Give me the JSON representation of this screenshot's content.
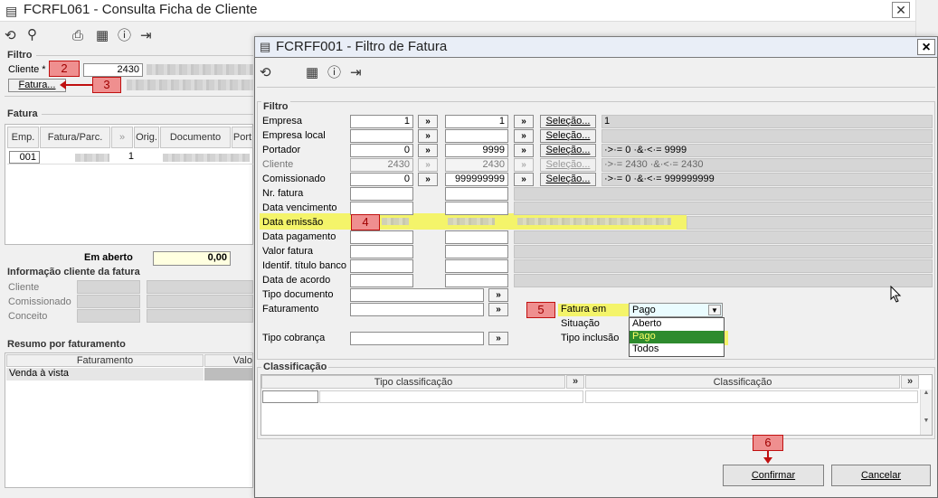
{
  "main": {
    "title": "FCRFL061 - Consulta Ficha de Cliente",
    "filtro_label": "Filtro",
    "cliente_label": "Cliente *",
    "cliente_value": "2430",
    "fatura_button": "Fatura...",
    "fatura_group": "Fatura",
    "grid_headers": [
      "Emp.",
      "Fatura/Parc.",
      "»",
      "Orig.",
      "Documento",
      "Port"
    ],
    "grid_row": {
      "emp": "001",
      "orig": "1"
    },
    "em_aberto_label": "Em aberto",
    "em_aberto_value": "0,00",
    "info_group": "Informação cliente da fatura",
    "info_labels": [
      "Cliente",
      "Comissionado",
      "Conceito"
    ],
    "resumo_group": "Resumo por faturamento",
    "resumo_headers": [
      "Faturamento",
      "Valo"
    ],
    "resumo_row": "Venda à vista"
  },
  "dialog": {
    "title": "FCRFF001 - Filtro de Fatura",
    "filtro_label": "Filtro",
    "rows": [
      {
        "label": "Empresa",
        "from": "1",
        "to": "1",
        "desc": "1"
      },
      {
        "label": "Empresa local",
        "from": "",
        "to": "",
        "desc": ""
      },
      {
        "label": "Portador",
        "from": "0",
        "to": "9999",
        "desc": "·>·= 0 ·&·<·= 9999"
      },
      {
        "label": "Cliente",
        "from": "2430",
        "to": "2430",
        "desc": "·>·= 2430 ·&·<·= 2430"
      },
      {
        "label": "Comissionado",
        "from": "0",
        "to": "999999999",
        "desc": "·>·= 0 ·&·<·= 999999999"
      },
      {
        "label": "Nr. fatura"
      },
      {
        "label": "Data vencimento"
      },
      {
        "label": "Data emissão"
      },
      {
        "label": "Data pagamento"
      },
      {
        "label": "Valor fatura"
      },
      {
        "label": "Identif. título banco"
      },
      {
        "label": "Data de acordo"
      }
    ],
    "selecao_label": "Seleção...",
    "arrow_label": "»",
    "tipo_documento_label": "Tipo documento",
    "faturamento_label": "Faturamento",
    "tipo_cobranca_label": "Tipo cobrança",
    "fatura_em_label": "Fatura em",
    "fatura_em_value": "Pago",
    "situacao_label": "Situação",
    "tipo_inclusao_label": "Tipo inclusão",
    "fatura_em_options": [
      "Aberto",
      "Pago",
      "Todos"
    ],
    "classificacao_label": "Classificação",
    "classificacao_headers": [
      "Tipo classificação",
      "Classificação"
    ],
    "confirmar_label": "Confirmar",
    "cancelar_label": "Cancelar",
    "close_label": "×"
  },
  "markers": [
    "2",
    "3",
    "4",
    "5",
    "6"
  ],
  "colors": {
    "highlight": "#f4f46a",
    "marker": "#ef8f8f",
    "selected": "#2e8b2e"
  }
}
